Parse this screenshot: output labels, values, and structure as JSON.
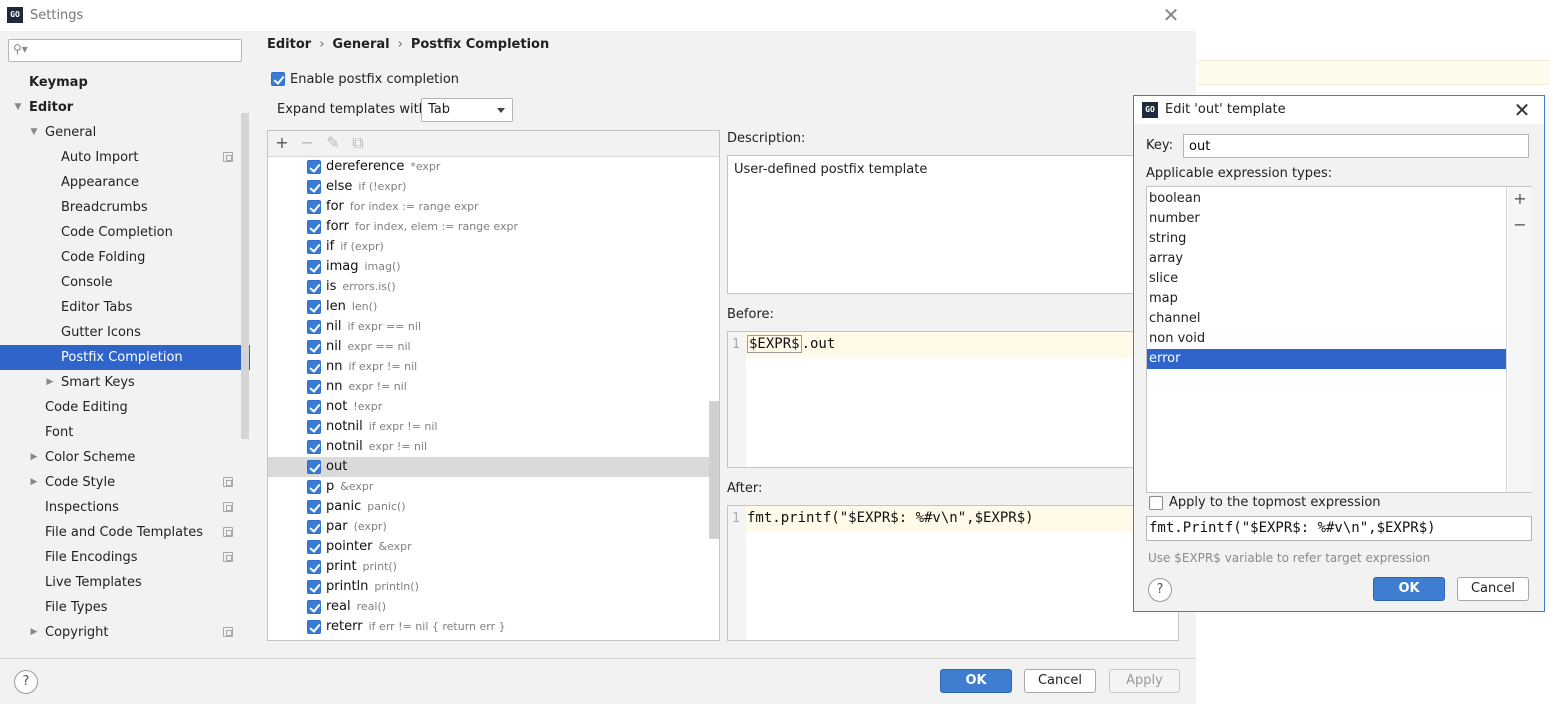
{
  "window": {
    "title": "Settings",
    "icon": "GO"
  },
  "search": {
    "placeholder": "",
    "value": ""
  },
  "tree": [
    {
      "label": "Keymap",
      "indent": 0,
      "bold": true
    },
    {
      "label": "Editor",
      "indent": 0,
      "bold": true,
      "arrow": "down"
    },
    {
      "label": "General",
      "indent": 1,
      "arrow": "down"
    },
    {
      "label": "Auto Import",
      "indent": 2,
      "project": true
    },
    {
      "label": "Appearance",
      "indent": 2
    },
    {
      "label": "Breadcrumbs",
      "indent": 2
    },
    {
      "label": "Code Completion",
      "indent": 2
    },
    {
      "label": "Code Folding",
      "indent": 2
    },
    {
      "label": "Console",
      "indent": 2
    },
    {
      "label": "Editor Tabs",
      "indent": 2
    },
    {
      "label": "Gutter Icons",
      "indent": 2
    },
    {
      "label": "Postfix Completion",
      "indent": 2,
      "selected": true
    },
    {
      "label": "Smart Keys",
      "indent": 2,
      "arrow": "right"
    },
    {
      "label": "Code Editing",
      "indent": 1
    },
    {
      "label": "Font",
      "indent": 1
    },
    {
      "label": "Color Scheme",
      "indent": 1,
      "arrow": "right"
    },
    {
      "label": "Code Style",
      "indent": 1,
      "arrow": "right",
      "project": true
    },
    {
      "label": "Inspections",
      "indent": 1,
      "project": true
    },
    {
      "label": "File and Code Templates",
      "indent": 1,
      "project": true
    },
    {
      "label": "File Encodings",
      "indent": 1,
      "project": true
    },
    {
      "label": "Live Templates",
      "indent": 1
    },
    {
      "label": "File Types",
      "indent": 1
    },
    {
      "label": "Copyright",
      "indent": 1,
      "arrow": "right",
      "project": true
    }
  ],
  "breadcrumb": [
    "Editor",
    "General",
    "Postfix Completion"
  ],
  "enable_postfix": {
    "label": "Enable postfix completion",
    "checked": true
  },
  "expand": {
    "label": "Expand templates with",
    "value": "Tab"
  },
  "templates": [
    {
      "key": "dereference",
      "example": "*expr"
    },
    {
      "key": "else",
      "example": "if (!expr)"
    },
    {
      "key": "for",
      "example": "for index := range expr"
    },
    {
      "key": "forr",
      "example": "for index, elem := range expr"
    },
    {
      "key": "if",
      "example": "if (expr)"
    },
    {
      "key": "imag",
      "example": "imag()"
    },
    {
      "key": "is",
      "example": "errors.is()"
    },
    {
      "key": "len",
      "example": "len()"
    },
    {
      "key": "nil",
      "example": "if expr == nil"
    },
    {
      "key": "nil",
      "example": "expr == nil"
    },
    {
      "key": "nn",
      "example": "if expr != nil"
    },
    {
      "key": "nn",
      "example": "expr != nil"
    },
    {
      "key": "not",
      "example": "!expr"
    },
    {
      "key": "notnil",
      "example": "if expr != nil"
    },
    {
      "key": "notnil",
      "example": "expr != nil"
    },
    {
      "key": "out",
      "example": "",
      "selected": true
    },
    {
      "key": "p",
      "example": "&expr"
    },
    {
      "key": "panic",
      "example": "panic()"
    },
    {
      "key": "par",
      "example": "(expr)"
    },
    {
      "key": "pointer",
      "example": "&expr"
    },
    {
      "key": "print",
      "example": "print()"
    },
    {
      "key": "println",
      "example": "println()"
    },
    {
      "key": "real",
      "example": "real()"
    },
    {
      "key": "reterr",
      "example": "if err != nil { return err }"
    }
  ],
  "description": {
    "label": "Description:",
    "text": "User-defined postfix template"
  },
  "before": {
    "label": "Before:",
    "line": "1",
    "expr": "$EXPR$",
    "rest": ".out"
  },
  "after": {
    "label": "After:",
    "line": "1",
    "code": "fmt.printf(\"$EXPR$: %#v\\n\",$EXPR$)"
  },
  "buttons": {
    "ok": "OK",
    "cancel": "Cancel",
    "apply": "Apply",
    "help": "?"
  },
  "dialog": {
    "icon": "GO",
    "title": "Edit 'out' template",
    "key_label": "Key:",
    "key_value": "out",
    "types_label": "Applicable expression types:",
    "types": [
      {
        "label": "boolean"
      },
      {
        "label": "number"
      },
      {
        "label": "string"
      },
      {
        "label": "array"
      },
      {
        "label": "slice"
      },
      {
        "label": "map"
      },
      {
        "label": "channel"
      },
      {
        "label": "non void"
      },
      {
        "label": "error",
        "selected": true
      }
    ],
    "topmost": {
      "label": "Apply to the topmost expression",
      "checked": false
    },
    "code": "fmt.Printf(\"$EXPR$: %#v\\n\",$EXPR$)",
    "hint": "Use $EXPR$ variable to refer target expression",
    "ok": "OK",
    "cancel": "Cancel",
    "help": "?"
  },
  "icons": {
    "add": "plus-icon",
    "remove": "minus-icon",
    "edit": "pencil-icon",
    "copy": "copy-icon",
    "search": "search-icon",
    "close": "close-icon"
  },
  "colors": {
    "accent": "#2f65ca",
    "primary_button": "#3f7dd1"
  }
}
